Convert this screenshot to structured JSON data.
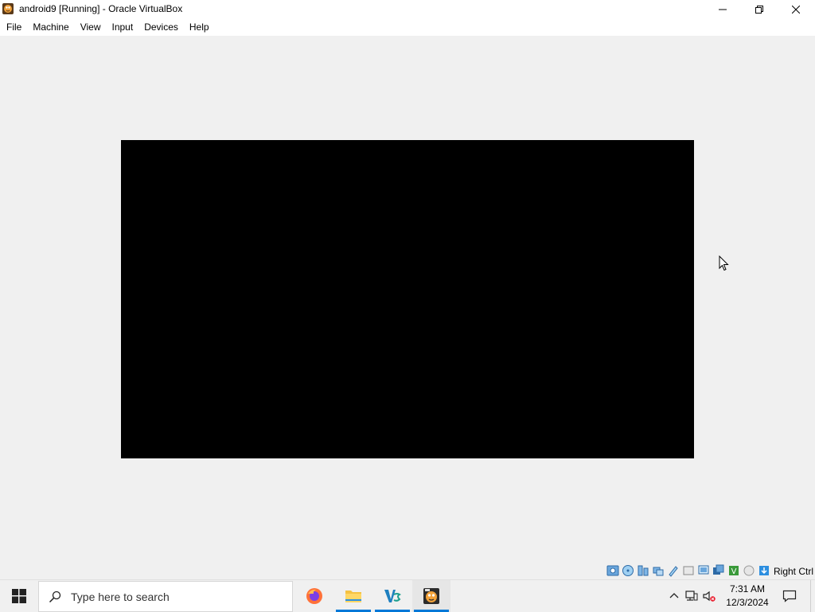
{
  "window": {
    "title": "android9 [Running] - Oracle VirtualBox",
    "app_icon": "virtualbox-icon",
    "caption_buttons": [
      "minimize-icon",
      "restore-icon",
      "close-icon"
    ]
  },
  "menu": {
    "items": [
      "File",
      "Machine",
      "View",
      "Input",
      "Devices",
      "Help"
    ]
  },
  "vm": {
    "screen_color": "#000000",
    "state": "Running"
  },
  "statusbar": {
    "icons": [
      "hard-disk-icon",
      "optical-drive-icon",
      "audio-icon",
      "network-icon",
      "usb-icon",
      "shared-folders-icon",
      "display-icon",
      "video-capture-icon",
      "virtualization-icon",
      "cpu-icon",
      "mouse-integration-icon",
      "keyboard-capture-icon"
    ],
    "host_key": "Right Ctrl"
  },
  "taskbar": {
    "search_placeholder": "Type here to search",
    "apps": [
      "firefox-icon",
      "file-explorer-icon",
      "vscode-icon",
      "virtualbox-icon"
    ],
    "tray_icons": [
      "chevron-up-icon",
      "network-icon",
      "volume-muted-icon"
    ],
    "time": "7:31 AM",
    "date": "12/3/2024",
    "accent_color": "#0078d7"
  }
}
